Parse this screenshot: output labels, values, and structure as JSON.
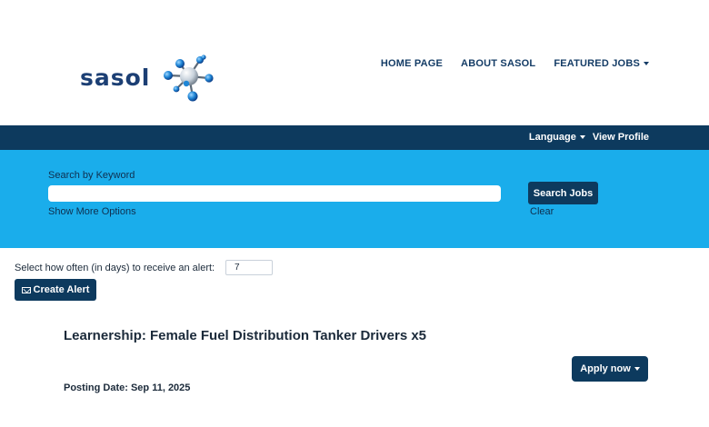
{
  "header": {
    "logo_text": "sasol",
    "nav": [
      {
        "label": "HOME PAGE",
        "has_dropdown": false
      },
      {
        "label": "ABOUT SASOL",
        "has_dropdown": false
      },
      {
        "label": "FEATURED JOBS",
        "has_dropdown": true
      }
    ]
  },
  "utility": {
    "language_label": "Language",
    "profile_label": "View Profile"
  },
  "search": {
    "keyword_label": "Search by Keyword",
    "keyword_value": "",
    "more_options_label": "Show More Options",
    "search_button_label": "Search Jobs",
    "clear_label": "Clear"
  },
  "alert": {
    "frequency_label": "Select how often (in days) to receive an alert:",
    "frequency_value": "7",
    "create_button_label": "Create Alert"
  },
  "job": {
    "title": "Learnership: Female Fuel Distribution Tanker Drivers x5",
    "apply_label": "Apply now",
    "posting_date_label": "Posting Date:",
    "posting_date_value": "Sep 11, 2025"
  },
  "colors": {
    "navy": "#0d3a5e",
    "search_panel": "#1aadeb",
    "logo_blue": "#1c3f74",
    "molecule_blue": "#1f86d6"
  },
  "icons": {
    "logo": "sasol-molecule-logo",
    "alert_button": "envelope-icon",
    "dropdown": "caret-down-icon"
  }
}
